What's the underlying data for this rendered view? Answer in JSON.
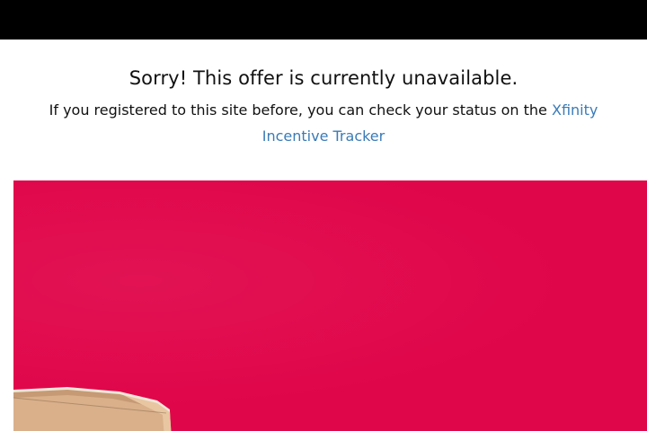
{
  "header": {
    "bar_color": "#000000"
  },
  "message": {
    "headline": "Sorry!  This offer is currently unavailable.",
    "subtext_before_link": "If you registered to this site before, you can check your status on the ",
    "link_text": "Xfinity Incentive Tracker",
    "link_color": "#3a7bb7"
  },
  "hero": {
    "background_color": "#e0064a",
    "image": "cardboard-box-on-red-background"
  }
}
